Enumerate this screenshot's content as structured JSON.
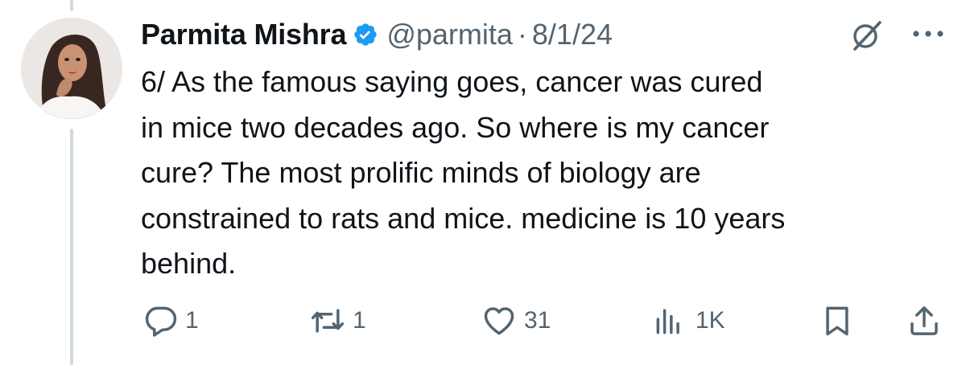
{
  "tweet": {
    "author_name": "Parmita Mishra",
    "handle": "@parmita",
    "separator": "·",
    "date": "8/1/24",
    "text": "6/ As the famous saying goes, cancer was cured\nin mice two decades ago. So where is my cancer\ncure? The most prolific minds of biology are\nconstrained to rats and mice. medicine is 10 years\nbehind.",
    "verified": true
  },
  "metrics": {
    "replies": "1",
    "reposts": "1",
    "likes": "31",
    "views": "1K"
  },
  "icons": {
    "verified": "verified-badge-icon",
    "grok": "grok-icon",
    "more": "more-icon",
    "reply": "reply-icon",
    "repost": "repost-icon",
    "like": "heart-icon",
    "views": "views-icon",
    "bookmark": "bookmark-icon",
    "share": "share-icon"
  },
  "colors": {
    "text_primary": "#0f1419",
    "text_secondary": "#536471",
    "verified_blue": "#1d9bf0",
    "thread_line": "#cfd9de"
  }
}
